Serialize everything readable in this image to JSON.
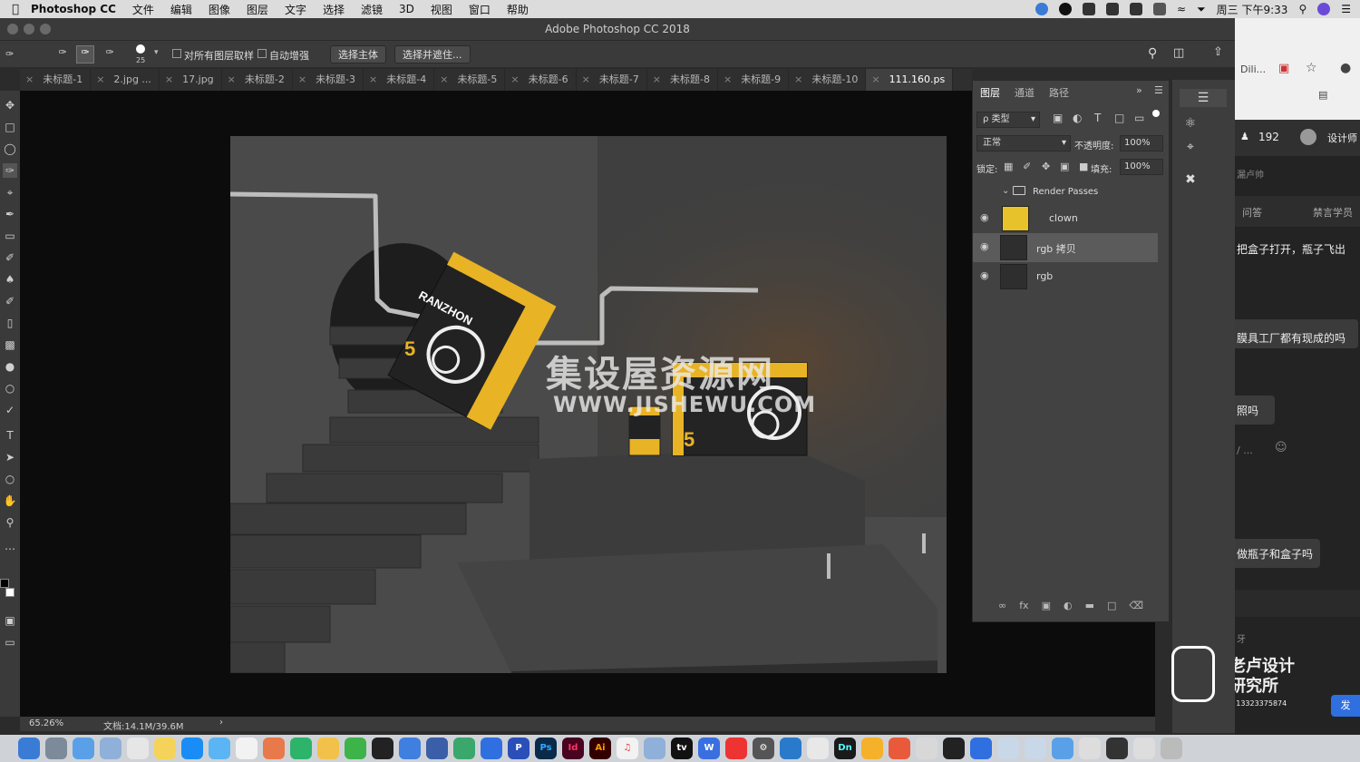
{
  "menubar": {
    "app_name": "Photoshop CC",
    "items": [
      "文件",
      "编辑",
      "图像",
      "图层",
      "文字",
      "选择",
      "滤镜",
      "3D",
      "视图",
      "窗口",
      "帮助"
    ],
    "clock": "周三 下午9:33"
  },
  "window": {
    "title": "Adobe Photoshop CC 2018"
  },
  "options_bar": {
    "brush_size": "25",
    "sample_all_layers": "对所有图层取样",
    "auto_enhance": "自动增强",
    "select_subject": "选择主体",
    "select_and_mask": "选择并遮住..."
  },
  "tabs": [
    "未标题-1",
    "2.jpg ...",
    "17.jpg",
    "未标题-2",
    "未标题-3",
    "未标题-4",
    "未标题-5",
    "未标题-6",
    "未标题-7",
    "未标题-8",
    "未标题-9",
    "未标题-10",
    "111.160.ps"
  ],
  "layers_panel": {
    "tabs": [
      "图层",
      "通道",
      "路径"
    ],
    "filter_kind": "ρ 类型",
    "blend_mode": "正常",
    "opacity_label": "不透明度:",
    "opacity_value": "100%",
    "lock_label": "锁定:",
    "fill_label": "填充:",
    "fill_value": "100%",
    "group_name": "Render Passes",
    "layers": [
      {
        "name": "clown",
        "visible": true,
        "selected": false
      },
      {
        "name": "rgb 拷贝",
        "visible": true,
        "selected": true
      },
      {
        "name": "rgb",
        "visible": true,
        "selected": false
      }
    ]
  },
  "status_bar": {
    "zoom": "65.26%",
    "doc_size": "文档:14.1M/39.6M",
    "arrow": "›"
  },
  "artwork": {
    "box_brand": "RANZHON",
    "box_number": "5",
    "watermark_title": "集设屋资源网",
    "watermark_url": "WWW.JISHEWU.COM"
  },
  "browser": {
    "tab_text": "Dili...",
    "count": "192",
    "user_label": "设计师",
    "lines": [
      "漏卢帅",
      "问答",
      "禁言学员",
      "把盒子打开，瓶子飞出",
      "膜具工厂都有现成的吗",
      "照吗",
      "/ ...",
      "做瓶子和盒子吗",
      "牙"
    ],
    "logo_line1": "老卢设计",
    "logo_line2": "研究所",
    "wechat": "微信号: 13323375874",
    "send": "发"
  },
  "dock_apps": [
    "Ps",
    "Id",
    "Ai",
    "Dn"
  ],
  "colors": {
    "photoshop_bg": "#3a3a3a",
    "canvas_bg": "#0c0c0c",
    "box_yellow": "#e8b325",
    "selection_row": "#5b5b5b"
  }
}
